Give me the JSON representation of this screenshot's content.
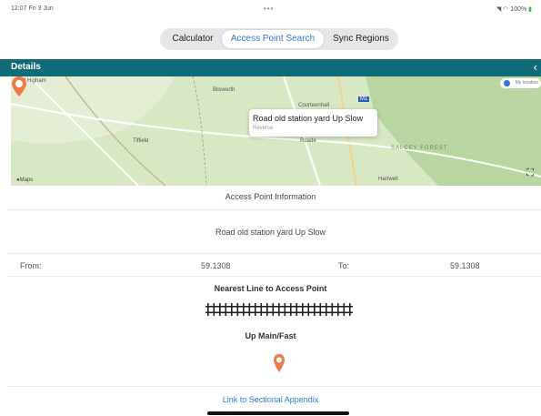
{
  "status_bar": {
    "time": "12:07  Fri 3 Jun",
    "dots": "•••",
    "right": "100%"
  },
  "tabs": [
    {
      "label": "Calculator",
      "selected": false
    },
    {
      "label": "Access Point Search",
      "selected": true
    },
    {
      "label": "Sync Regions",
      "selected": false
    }
  ],
  "details": {
    "title": "Details",
    "back_icon": "chevron-left-icon"
  },
  "map": {
    "labels": [
      "Cold Higham",
      "Blisworth",
      "Courteenhall",
      "Tiffield",
      "Roade",
      "SALCEY FOREST",
      "Hartwell"
    ],
    "road_badge": "M1",
    "popup_title": "Road old station yard Up Slow",
    "popup_subtitle": "Reverse",
    "maps_logo": "Maps",
    "location_pill": "My location"
  },
  "info": {
    "section_title": "Access Point Information",
    "name": "Road old station yard Up Slow",
    "from_label": "From:",
    "from_value": "59.1308",
    "to_label": "To:",
    "to_value": "59.1308",
    "nearest_title": "Nearest Line to Access Point",
    "line_name": "Up Main/Fast",
    "link_label": "Link to Sectional Appendix"
  },
  "colors": {
    "header": "#0f6b78",
    "accent": "#2b7bd6",
    "pin": "#f07a4a"
  }
}
